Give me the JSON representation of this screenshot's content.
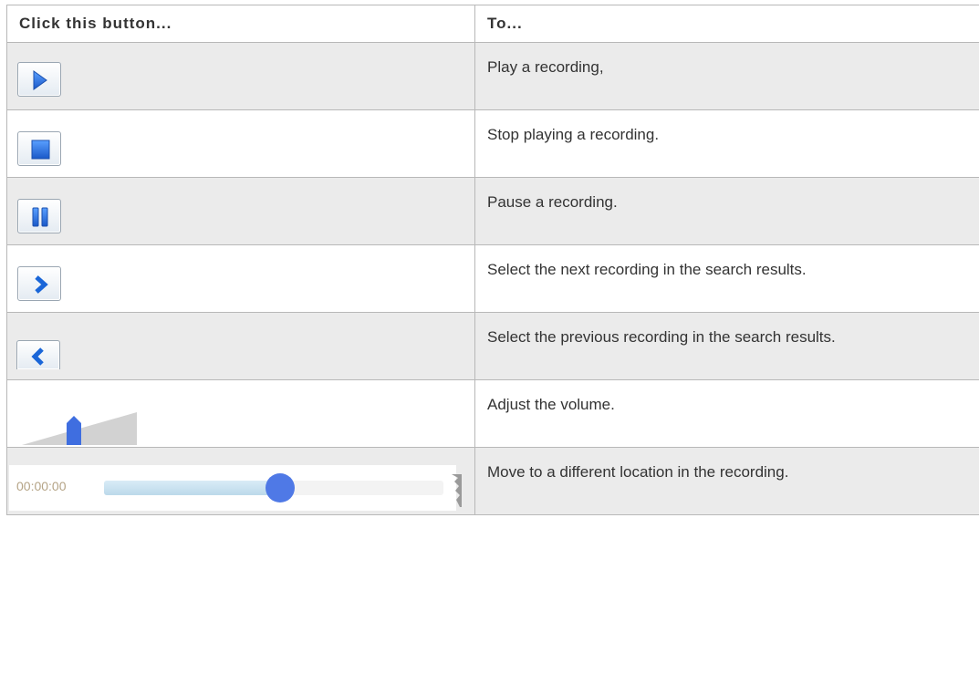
{
  "table": {
    "headers": [
      "Click this button...",
      "To..."
    ],
    "rows": [
      {
        "icon": "play-icon",
        "description": "Play a recording,"
      },
      {
        "icon": "stop-icon",
        "description": "Stop playing a recording."
      },
      {
        "icon": "pause-icon",
        "description": "Pause a recording."
      },
      {
        "icon": "next-icon",
        "description": "Select the next recording in the search results."
      },
      {
        "icon": "previous-icon",
        "description": "Select the previous recording in the search results."
      },
      {
        "icon": "volume-slider",
        "description": "Adjust the volume."
      },
      {
        "icon": "seek-bar",
        "description": "Move to a different location in the recording."
      }
    ]
  },
  "seek": {
    "time": "00:00:00",
    "position": 0.52
  },
  "volume": {
    "level": 0.5
  },
  "colors": {
    "accent": "#2f6fd6",
    "border": "#b8b8b8",
    "shaded_row": "#ebebeb"
  }
}
